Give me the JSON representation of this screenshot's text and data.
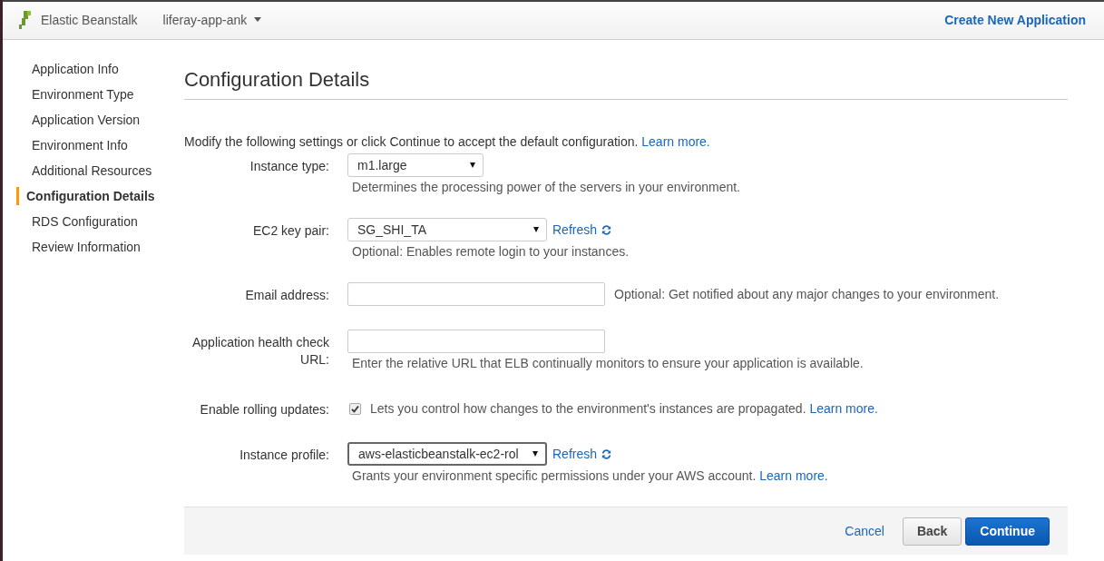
{
  "top_bar": {
    "product": "Elastic Beanstalk",
    "application": "liferay-app-ank",
    "action": "Create New Application"
  },
  "sidebar": {
    "items": [
      {
        "label": "Application Info",
        "selected": false
      },
      {
        "label": "Environment Type",
        "selected": false
      },
      {
        "label": "Application Version",
        "selected": false
      },
      {
        "label": "Environment Info",
        "selected": false
      },
      {
        "label": "Additional Resources",
        "selected": false
      },
      {
        "label": "Configuration Details",
        "selected": true
      },
      {
        "label": "RDS Configuration",
        "selected": false
      },
      {
        "label": "Review Information",
        "selected": false
      }
    ]
  },
  "page": {
    "title": "Configuration Details",
    "intro": "Modify the following settings or click Continue to accept the default configuration.",
    "intro_link": "Learn more."
  },
  "form": {
    "rows": [
      {
        "kind": "select",
        "label": "Instance type:",
        "value": "m1.large",
        "help": "Determines the processing power of the servers in your environment."
      },
      {
        "kind": "select",
        "label": "EC2 key pair:",
        "value": "SG_SHI_TA",
        "refresh": "Refresh",
        "help": "Optional: Enables remote login to your instances."
      },
      {
        "kind": "text",
        "label": "Email address:",
        "side_note": "Optional: Get notified about any major changes to your environment."
      },
      {
        "kind": "text",
        "label": "Application health check URL:",
        "help": "Enter the relative URL that ELB continually monitors to ensure your application is available."
      },
      {
        "kind": "checkbox",
        "label": "Enable rolling updates:",
        "checked": true,
        "text": "Lets you control how changes to the environment's instances are propagated.",
        "link": "Learn more."
      },
      {
        "kind": "select",
        "label": "Instance profile:",
        "value": "aws-elasticbeanstalk-ec2-rol",
        "focused": true,
        "refresh": "Refresh",
        "help": "Grants your environment specific permissions under your AWS account.",
        "link": "Learn more."
      }
    ]
  },
  "footer": {
    "cancel": "Cancel",
    "back": "Back",
    "continue": "Continue"
  }
}
